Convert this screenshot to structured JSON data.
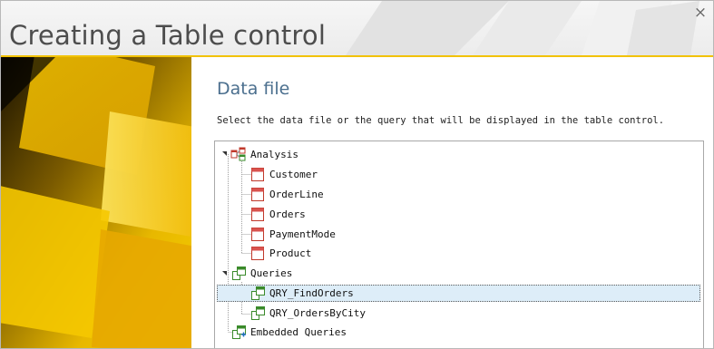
{
  "window": {
    "title": "Creating a Table control",
    "close_glyph": "×"
  },
  "page": {
    "heading": "Data file",
    "description": "Select the data file or the query that will be displayed in the table control."
  },
  "tree": {
    "analysis": {
      "label": "Analysis",
      "icon": "analysis-icon",
      "expanded": true,
      "children": [
        "Customer",
        "OrderLine",
        "Orders",
        "PaymentMode",
        "Product"
      ]
    },
    "queries": {
      "label": "Queries",
      "icon": "query-icon",
      "expanded": true,
      "children": [
        "QRY_FindOrders",
        "QRY_OrdersByCity"
      ],
      "selected": "QRY_FindOrders"
    },
    "embedded": {
      "label": "Embedded Queries",
      "icon": "embedded-query-icon"
    }
  },
  "colors": {
    "title_text": "#4d4d4d",
    "heading_text": "#4b6f8e",
    "accent_yellow": "#f2c200",
    "selection_bg": "#ddedf8",
    "file_icon_red": "#d9534f",
    "query_icon_green": "#3a8a2a"
  }
}
